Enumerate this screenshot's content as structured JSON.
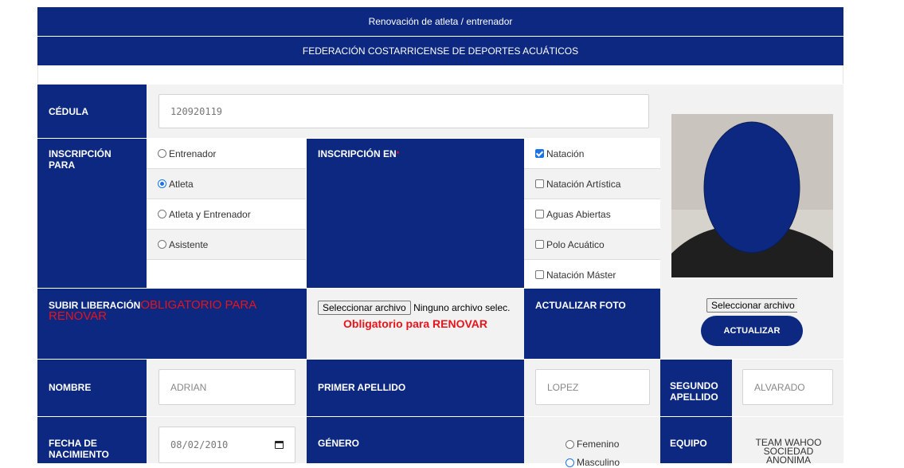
{
  "header": {
    "title": "Renovación de atleta / entrenador",
    "subtitle": "FEDERACIÓN COSTARRICENSE DE DEPORTES ACUÁTICOS"
  },
  "cedula": {
    "label": "CÉDULA",
    "value": "120920119"
  },
  "inscripcion_para": {
    "label": "INSCRIPCIÓN PARA",
    "options": [
      "Entrenador",
      "Atleta",
      "Atleta y Entrenador",
      "Asistente"
    ],
    "selected": "Atleta"
  },
  "inscripcion_en": {
    "label": "INSCRIPCIÓN EN",
    "required_mark": "*",
    "options": [
      "Natación",
      "Natación Artística",
      "Aguas Abiertas",
      "Polo Acuático",
      "Natación Máster"
    ],
    "checked": [
      "Natación"
    ]
  },
  "liberacion": {
    "label": "SUBIR LIBERACIÓN",
    "label_required": "OBLIGATORIO PARA RENOVAR",
    "file_button": "Seleccionar archivo",
    "file_status": "Ninguno archivo selec.",
    "note": "Obligatorio para RENOVAR"
  },
  "foto": {
    "label": "ACTUALIZAR FOTO",
    "file_button": "Seleccionar archivo",
    "update_button": "ACTUALIZAR"
  },
  "nombre": {
    "label": "NOMBRE",
    "value": "ADRIAN"
  },
  "primer_apellido": {
    "label": "PRIMER APELLIDO",
    "value": "LOPEZ"
  },
  "segundo_apellido": {
    "label": "SEGUNDO APELLIDO",
    "value": "ALVARADO"
  },
  "fecha_nacimiento": {
    "label": "FECHA DE NACIMIENTO",
    "value": "08/02/2010"
  },
  "genero": {
    "label": "GÉNERO",
    "options": [
      "Femenino",
      "Masculino"
    ]
  },
  "equipo": {
    "label": "EQUIPO",
    "value": "TEAM WAHOO SOCIEDAD ANONIMA"
  },
  "icons": {
    "calendar": "calendar-icon",
    "photo": "profile-photo"
  },
  "colors": {
    "navy": "#0c2880",
    "required_red": "#e8141b",
    "checkbox_blue": "#1a73e8"
  }
}
